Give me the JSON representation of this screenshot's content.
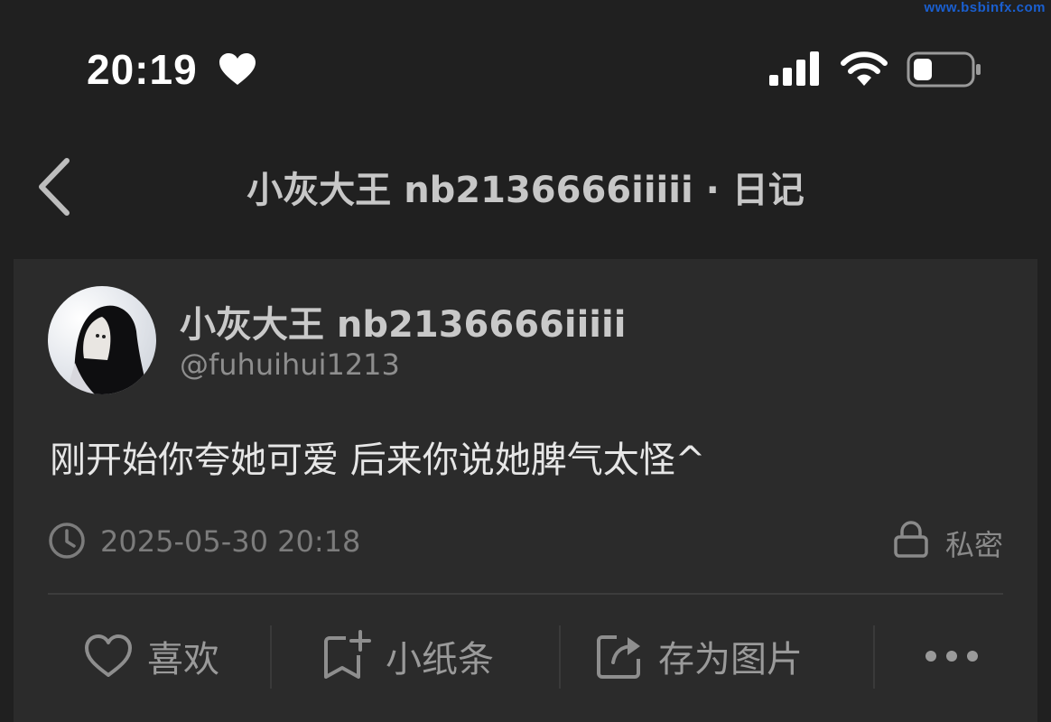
{
  "watermark": "www.bsbinfx.com",
  "status_bar": {
    "time": "20:19",
    "icons": [
      "heart-icon",
      "signal-icon",
      "wifi-icon",
      "battery-icon"
    ]
  },
  "nav": {
    "title": "小灰大王 nb2136666iiiii · 日记",
    "back_icon": "chevron-left-icon"
  },
  "post": {
    "author_name": "小灰大王 nb2136666iiiii",
    "author_handle": "@fuhuihui1213",
    "content": "刚开始你夸她可爱 后来你说她脾气太怪^",
    "timestamp": "2025-05-30 20:18",
    "privacy": "私密"
  },
  "actions": [
    {
      "label": "喜欢",
      "icon": "heart-outline-icon"
    },
    {
      "label": "小纸条",
      "icon": "bookmark-add-icon"
    },
    {
      "label": "存为图片",
      "icon": "share-image-icon"
    },
    {
      "label": "",
      "icon": "more-icon"
    }
  ],
  "colors": {
    "background": "#202020",
    "card": "#2b2b2b",
    "primary_text": "#e6e6e6",
    "secondary_text": "#8e8e8e",
    "watermark": "#1a5fd0"
  }
}
